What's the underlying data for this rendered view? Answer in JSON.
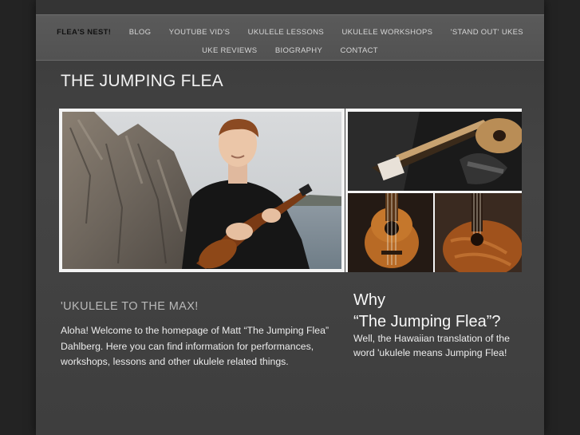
{
  "nav": {
    "row1": [
      "FLEA'S NEST!",
      "BLOG",
      "YOUTUBE VID'S",
      "UKULELE LESSONS",
      "UKULELE WORKSHOPS",
      "'STAND OUT' UKES"
    ],
    "row2": [
      "UKE REVIEWS",
      "BIOGRAPHY",
      "CONTACT"
    ],
    "active": "FLEA'S NEST!"
  },
  "site": {
    "title": "THE JUMPING FLEA"
  },
  "main": {
    "tagline": "'UKULELE TO THE MAX!",
    "intro": "Aloha! Welcome to the homepage of Matt “The Jumping Flea” Dahlberg. Here you can find information for performances, workshops, lessons and other ukulele related things."
  },
  "sidebar": {
    "heading_line1": "Why",
    "heading_line2": "“The Jumping Flea”?",
    "body": "Well, the Hawaiian translation of the word 'ukulele means Jumping Flea!"
  },
  "colors": {
    "background": "#232323",
    "panel": "#404040",
    "nav": "#565656",
    "text": "#ececec"
  }
}
